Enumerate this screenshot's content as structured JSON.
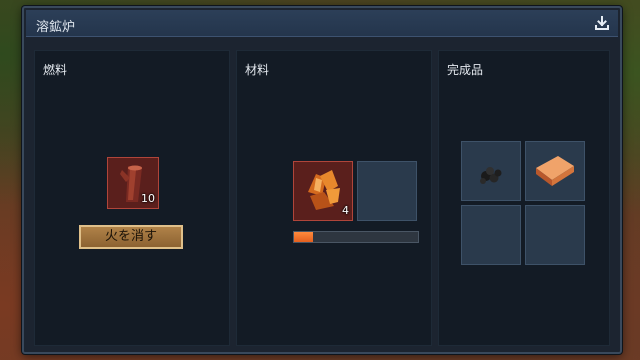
{
  "window": {
    "title": "溶鉱炉",
    "download_icon": "download-icon"
  },
  "fuel": {
    "header": "燃料",
    "item_icon": "wood-log-icon",
    "quantity": "10",
    "extinguish_label": "火を消す"
  },
  "material": {
    "header": "材料",
    "item_icon": "copper-ore-icon",
    "quantity": "4",
    "progress": 0.15,
    "progress_color": "#ff7a2e"
  },
  "output": {
    "header": "完成品",
    "items": [
      {
        "icon": "coal-icon"
      },
      {
        "icon": "copper-ingot-icon"
      }
    ]
  }
}
